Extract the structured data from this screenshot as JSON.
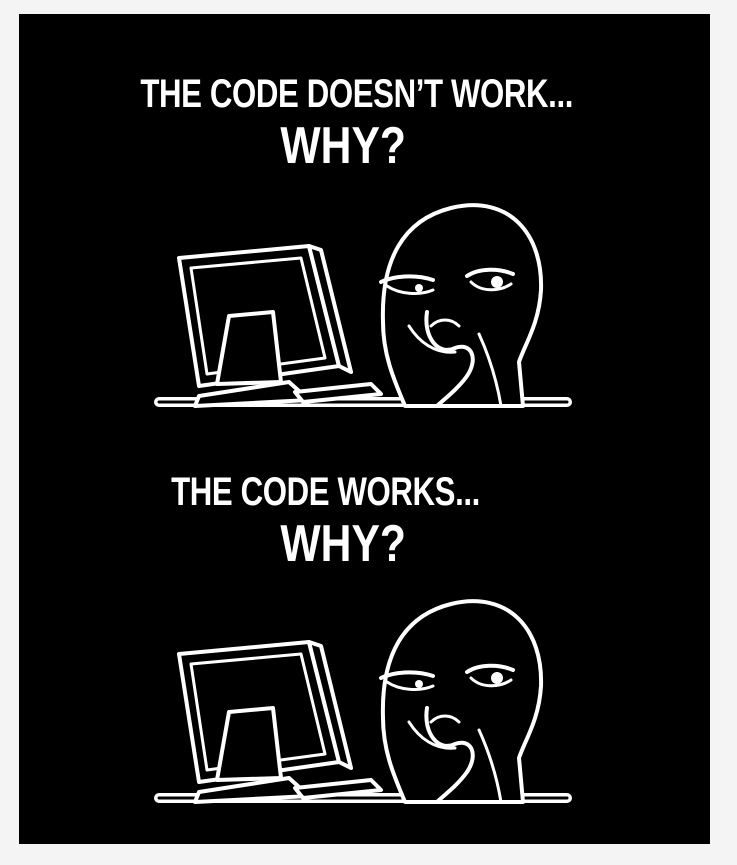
{
  "meme": {
    "panels": [
      {
        "caption_line1": "THE CODE DOESN’T WORK...",
        "caption_line2": "WHY?"
      },
      {
        "caption_line1": "THE CODE WORKS...",
        "caption_line2": "WHY?"
      }
    ]
  },
  "colors": {
    "background": "#000000",
    "outer_frame": "#f4f4f4",
    "ink": "#ffffff"
  },
  "icons": [
    "computer-monitor-icon",
    "keyboard-icon",
    "puzzled-rage-face-icon"
  ]
}
